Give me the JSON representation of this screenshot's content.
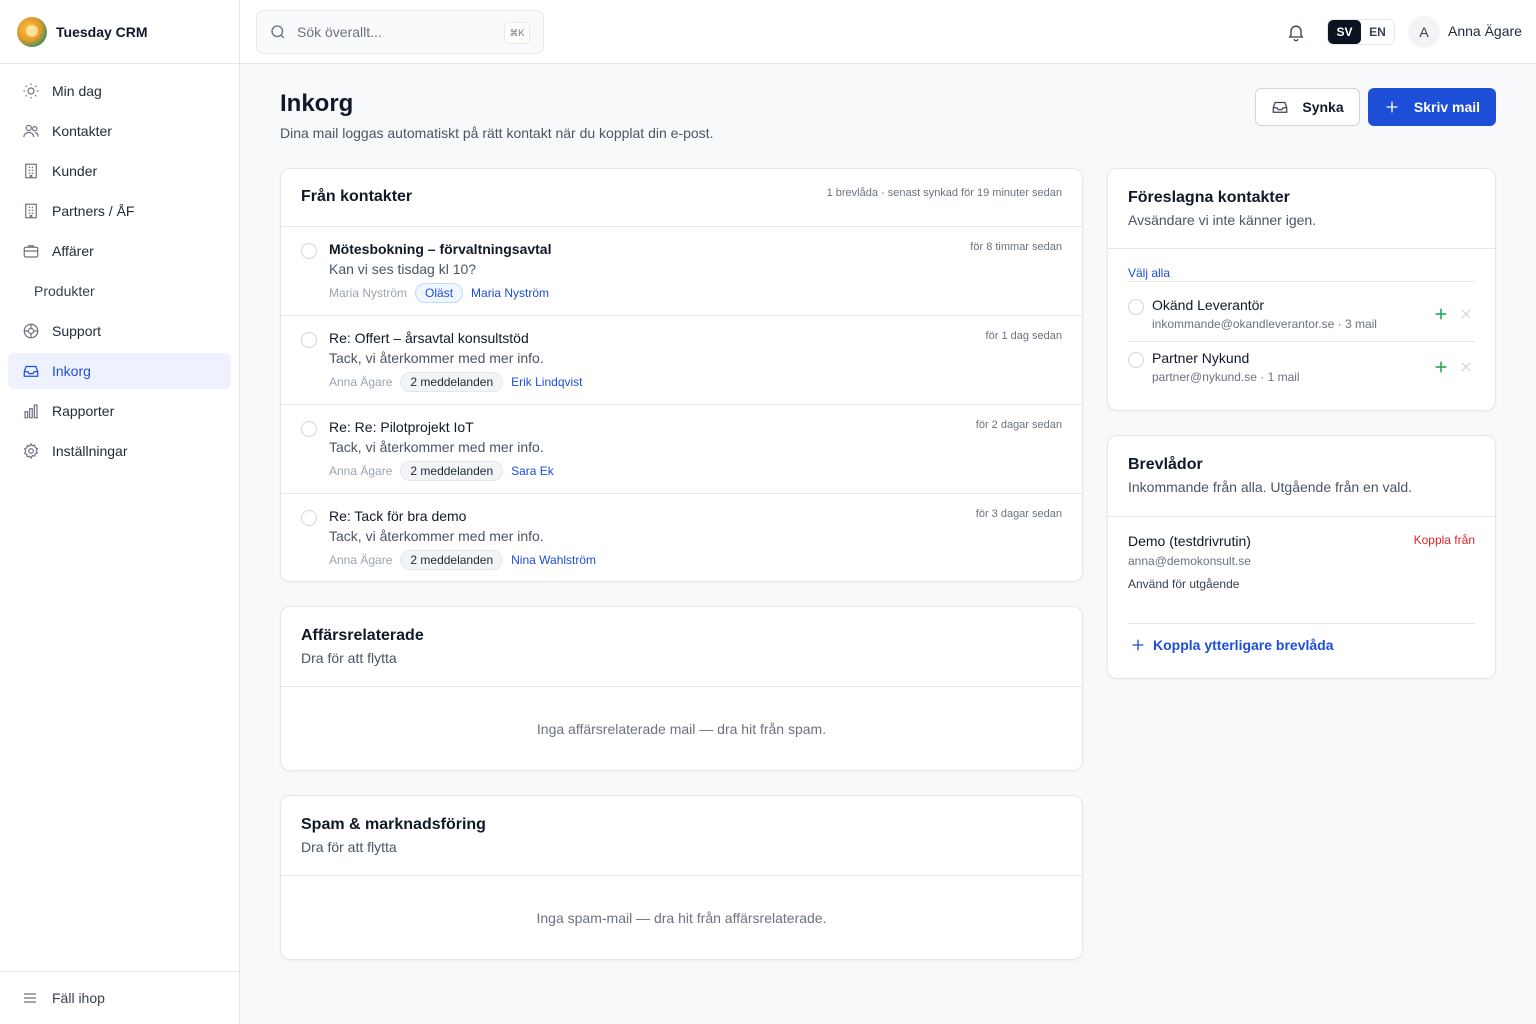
{
  "app": {
    "name": "Tuesday CRM"
  },
  "sidebar": {
    "items": [
      {
        "label": "Min dag",
        "icon": "sun-icon"
      },
      {
        "label": "Kontakter",
        "icon": "users-icon"
      },
      {
        "label": "Kunder",
        "icon": "building-icon"
      },
      {
        "label": "Partners / ÅF",
        "icon": "building-icon"
      },
      {
        "label": "Affärer",
        "icon": "briefcase-icon"
      },
      {
        "label": "Produkter",
        "icon": ""
      },
      {
        "label": "Support",
        "icon": "lifebuoy-icon"
      },
      {
        "label": "Inkorg",
        "icon": "inbox-icon",
        "active": true
      },
      {
        "label": "Rapporter",
        "icon": "bar-chart-icon"
      },
      {
        "label": "Inställningar",
        "icon": "gear-icon"
      }
    ],
    "collapse_label": "Fäll ihop"
  },
  "topbar": {
    "search_placeholder": "Sök överallt...",
    "shortcut": "⌘K",
    "lang_sv": "SV",
    "lang_en": "EN",
    "active_lang": "SV",
    "avatar_initial": "A",
    "user_name": "Anna Ägare"
  },
  "page": {
    "title": "Inkorg",
    "subtitle": "Dina mail loggas automatiskt på rätt kontakt när du kopplat din e-post.",
    "sync_label": "Synka",
    "write_label": "Skriv mail"
  },
  "from_contacts": {
    "title": "Från kontakter",
    "meta": "1 brevlåda · senast synkad för 19 minuter sedan",
    "mails": [
      {
        "subject": "Mötesbokning – förvaltningsavtal",
        "preview": "Kan vi ses tisdag kl 10?",
        "from": "Maria Nyström",
        "chip": "Oläst",
        "contact": "Maria Nyström",
        "time": "för 8 timmar sedan",
        "unread": true
      },
      {
        "subject": "Re: Offert – årsavtal konsultstöd",
        "preview": "Tack, vi återkommer med mer info.",
        "from": "Anna Ägare",
        "chip": "2 meddelanden",
        "contact": "Erik Lindqvist",
        "time": "för 1 dag sedan",
        "unread": false
      },
      {
        "subject": "Re: Re: Pilotprojekt IoT",
        "preview": "Tack, vi återkommer med mer info.",
        "from": "Anna Ägare",
        "chip": "2 meddelanden",
        "contact": "Sara Ek",
        "time": "för 2 dagar sedan",
        "unread": false
      },
      {
        "subject": "Re: Tack för bra demo",
        "preview": "Tack, vi återkommer med mer info.",
        "from": "Anna Ägare",
        "chip": "2 meddelanden",
        "contact": "Nina Wahlström",
        "time": "för 3 dagar sedan",
        "unread": false
      }
    ]
  },
  "business": {
    "title": "Affärsrelaterade",
    "subtitle": "Dra för att flytta",
    "empty": "Inga affärsrelaterade mail — dra hit från spam."
  },
  "spam": {
    "title": "Spam & marknadsföring",
    "subtitle": "Dra för att flytta",
    "empty": "Inga spam-mail — dra hit från affärsrelaterade."
  },
  "suggested": {
    "title": "Föreslagna kontakter",
    "subtitle": "Avsändare vi inte känner igen.",
    "select_all": "Välj alla",
    "items": [
      {
        "name": "Okänd Leverantör",
        "detail": "inkommande@okandleverantor.se · 3 mail"
      },
      {
        "name": "Partner Nykund",
        "detail": "partner@nykund.se · 1 mail"
      }
    ]
  },
  "mailboxes": {
    "title": "Brevlådor",
    "subtitle": "Inkommande från alla. Utgående från en vald.",
    "box_name": "Demo (testdrivrutin)",
    "box_email": "anna@demokonsult.se",
    "box_use": "Använd för utgående",
    "disconnect": "Koppla från",
    "add_label": "Koppla ytterligare brevlåda"
  },
  "colors": {
    "accent": "#1d4ed8",
    "danger": "#dc2626",
    "success": "#16a34a"
  }
}
